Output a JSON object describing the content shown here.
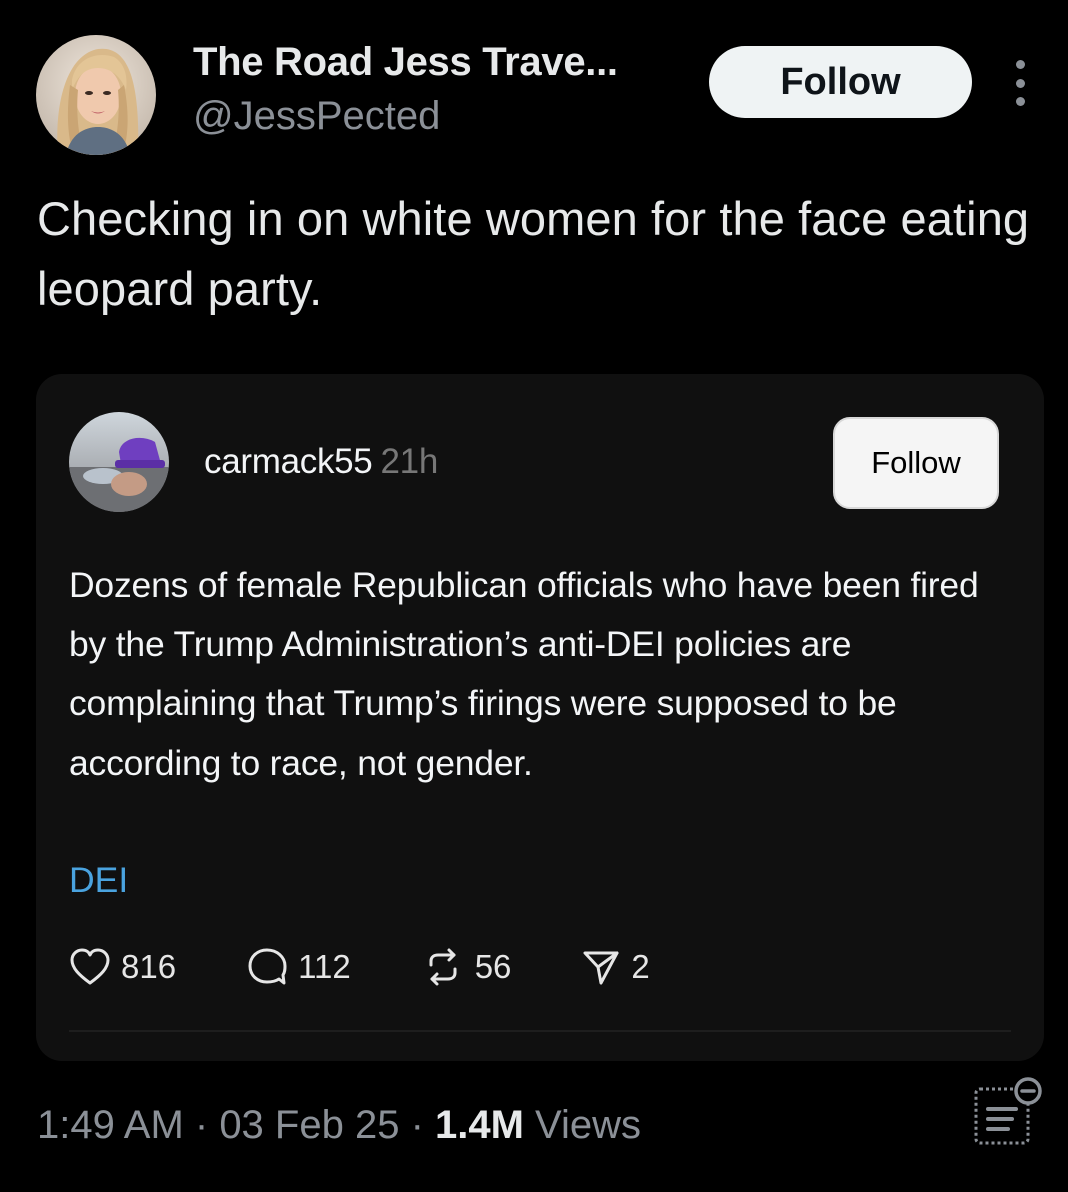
{
  "post": {
    "author": {
      "display_name": "The Road Jess Trave...",
      "handle": "@JessPected",
      "avatar_icon": "profile-photo-blonde-woman"
    },
    "follow_label": "Follow",
    "more_icon": "more-vertical-icon",
    "text": "Checking in on white women for the face eating leopard party."
  },
  "embed": {
    "username": "carmack55",
    "time": "21h",
    "avatar_icon": "profile-photo-purple-hat",
    "follow_label": "Follow",
    "text": "Dozens of female Republican officials who have been fired by the Trump Administration’s anti-DEI policies are complaining that Trump’s firings were supposed to be according to race, not gender.",
    "tag": "DEI",
    "actions": {
      "likes": "816",
      "replies": "112",
      "reposts": "56",
      "shares": "2"
    }
  },
  "meta": {
    "time": "1:49 AM",
    "separator": " · ",
    "date": "03 Feb 25",
    "views_count": "1.4M",
    "views_label": " Views",
    "analytics_icon": "post-analytics-icon"
  },
  "colors": {
    "background": "#000000",
    "text_primary": "#e7e9ea",
    "text_secondary": "#8b9097",
    "card_background": "#101010",
    "link_blue": "#4aa3df"
  }
}
